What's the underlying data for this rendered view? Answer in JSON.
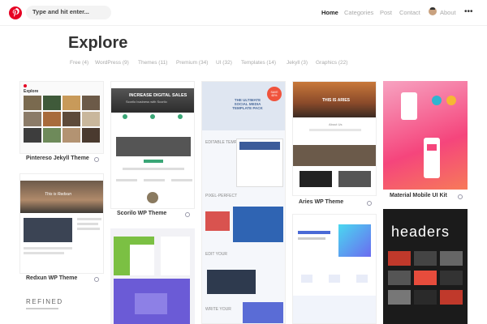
{
  "search": {
    "placeholder": "Type and hit enter..."
  },
  "nav": {
    "home": "Home",
    "categories": "Categories",
    "post": "Post",
    "contact": "Contact",
    "about": "About"
  },
  "page": {
    "title": "Explore"
  },
  "filters": [
    "Free (4)",
    "WordPress (9)",
    "Themes (11)",
    "Premium (34)",
    "UI (32)",
    "Templates (14)",
    "Jekyll (3)",
    "Graphics (22)"
  ],
  "cards": [
    {
      "caption": "Pintereso Jekyll Theme",
      "preview_title": "Explore"
    },
    {
      "caption": "Redxun WP Theme",
      "preview_title": "This is Redxun"
    },
    {
      "caption": "Scorilo WP Theme",
      "preview_title": "INCREASE DIGITAL SALES",
      "preview_sub": "Scorilo business with Scorilo"
    },
    {
      "caption": "",
      "preview_title": "THE ULTIMATE SOCIAL MEDIA TEMPLATE PACK",
      "badge": "SAVE 60%",
      "labels": [
        "EDITABLE TEMPLATES",
        "PIXEL-PERFECT",
        "EDIT YOUR",
        "WRITE YOUR"
      ]
    },
    {
      "caption": "Aries WP Theme",
      "preview_title": "THIS IS ARIES",
      "preview_sub": "About Us"
    },
    {
      "caption": "Material Mobile UI Kit"
    },
    {
      "caption": "",
      "preview_title": "headers"
    },
    {
      "caption": "",
      "preview_title": "REFINED"
    }
  ],
  "colors": {
    "brand": "#e60023",
    "pink": "#f5457c"
  }
}
